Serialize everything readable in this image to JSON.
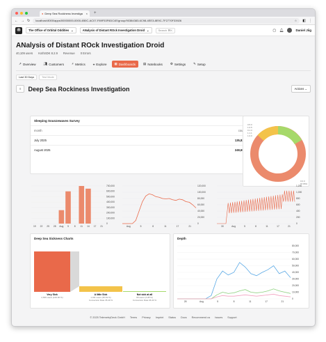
{
  "browser": {
    "tab_title": "Deep Sea Rockiness Investiga",
    "url": "localhost:8000/apps/00000000-0000-4B0C-AC07-F89F53F6DC4E/group/90384383-6C98-4EE3-8E9C-7F2770F33926"
  },
  "nav": {
    "org": "The Office of Orbital Oddities",
    "app": "ANalysis of Distant ROck Investigation Droid",
    "search": "Search ⌘K",
    "user": "Daniel Jiig"
  },
  "app": {
    "title": "ANalysis of Distant ROck Investigation Droid",
    "users": "40,109 users",
    "sdk": "KothSDK 8.2.9",
    "revenue": "Revenue",
    "errors": "0 Errors"
  },
  "tabs": [
    {
      "label": "Overview"
    },
    {
      "label": "Customers"
    },
    {
      "label": "Metrics"
    },
    {
      "label": "Explore"
    },
    {
      "label": "Dashboards"
    },
    {
      "label": "Notebooks"
    },
    {
      "label": "Settings"
    },
    {
      "label": "Setup"
    }
  ],
  "filters": {
    "range": "Last 30 Days",
    "mode": "Test Mode"
  },
  "dashboard": {
    "title": "Deep Sea Rockiness Investigation",
    "actions": "Actions"
  },
  "survey": {
    "title": "Sleeping Sounzewaves Survey",
    "col1": "month",
    "col2": "count",
    "rows": [
      {
        "month": "July 2025",
        "count": "135,831"
      },
      {
        "month": "August 2025",
        "count": "249,692"
      }
    ]
  },
  "donut": {
    "labels": [
      "0.5.0",
      "1.0.5",
      "0.1.3",
      "1.1.1",
      "1.0.0"
    ],
    "bottom": [
      "0.0.0",
      "97.86%"
    ]
  },
  "funnel": {
    "title": "Deep Sea Sickness Charts",
    "steps": [
      {
        "name": "Very Sick",
        "val": "2,849 users (100.00 %)",
        "conv": ""
      },
      {
        "name": "A little Sick",
        "val": "1,011 users (35.49 %)",
        "conv": "Conversion Rate 35.49 %"
      },
      {
        "name": "Not sick at all",
        "val": "65 users (2.28 %)",
        "conv": "Conversion Rate 06.43 %"
      }
    ]
  },
  "depth": {
    "title": "Depth"
  },
  "footer": [
    "© 2025 TelemetryDeck GmbH",
    "Terms",
    "Privacy",
    "Imprint",
    "Status",
    "Docs",
    "Recommend us",
    "Issues",
    "Support"
  ],
  "chart_data": [
    {
      "type": "bar",
      "categories": [
        "19",
        "22",
        "25",
        "28",
        "Aug",
        "5",
        "8",
        "11",
        "14",
        "17",
        "21"
      ],
      "values": [
        0,
        0,
        0,
        0,
        250000,
        600000,
        0,
        700000,
        650000,
        0,
        0
      ],
      "ylim": [
        0,
        700000
      ],
      "ytick_labels": [
        "0",
        "100,000",
        "200,000",
        "300,000",
        "400,000",
        "500,000",
        "600,000",
        "700,000"
      ]
    },
    {
      "type": "line",
      "x_labels": [
        "Aug",
        "5",
        "8",
        "11",
        "17",
        "21"
      ],
      "ylim": [
        0,
        120000
      ],
      "ytick_labels": [
        "0",
        "20,000",
        "40,000",
        "60,000",
        "80,000",
        "100,000",
        "120,000"
      ]
    },
    {
      "type": "line",
      "x_labels": [
        "30",
        "Aug",
        "5",
        "8",
        "11",
        "17",
        "21"
      ],
      "ylim": [
        0,
        1200
      ],
      "ytick_labels": [
        "0",
        "200",
        "400",
        "600",
        "800",
        "1,000",
        "1,200"
      ]
    },
    {
      "type": "line",
      "x_labels": [
        "28",
        "Aug",
        "5",
        "8",
        "11",
        "17",
        "21"
      ],
      "ylim": [
        0,
        80000
      ],
      "ytick_labels": [
        "0",
        "10,000",
        "20,000",
        "30,000",
        "40,000",
        "50,000",
        "60,000",
        "70,000",
        "80,000"
      ]
    }
  ]
}
